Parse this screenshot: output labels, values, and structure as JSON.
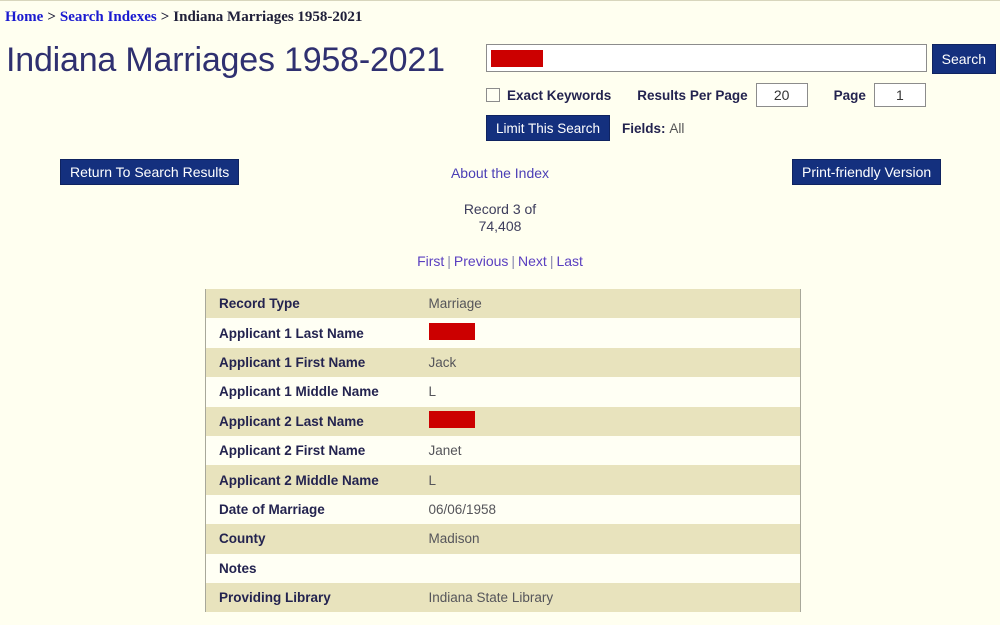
{
  "breadcrumb": {
    "home": "Home",
    "separator": ">",
    "search_indexes": "Search Indexes",
    "current": "Indiana Marriages 1958-2021"
  },
  "page_title": "Indiana Marriages 1958-2021",
  "search": {
    "query_value": "",
    "query_redacted": true,
    "search_button": "Search",
    "exact_keywords_label": "Exact Keywords",
    "exact_keywords_checked": false,
    "results_per_page_label": "Results Per Page",
    "results_per_page_value": "20",
    "page_label": "Page",
    "page_value": "1",
    "limit_search_button": "Limit This Search",
    "fields_label": "Fields:",
    "fields_value": "All"
  },
  "actions": {
    "return_button": "Return To Search Results",
    "print_button": "Print-friendly Version"
  },
  "nav": {
    "about_link": "About the Index",
    "record_position": "Record 3 of 74,408",
    "first": "First",
    "previous": "Previous",
    "next": "Next",
    "last": "Last",
    "divider": "|"
  },
  "record": {
    "rows": [
      {
        "label": "Record Type",
        "value": "Marriage",
        "redacted": false,
        "shade": "tan"
      },
      {
        "label": "Applicant 1 Last Name",
        "value": "",
        "redacted": true,
        "shade": "light"
      },
      {
        "label": "Applicant 1 First Name",
        "value": "Jack",
        "redacted": false,
        "shade": "tan"
      },
      {
        "label": "Applicant 1 Middle Name",
        "value": "L",
        "redacted": false,
        "shade": "light"
      },
      {
        "label": "Applicant 2 Last Name",
        "value": "",
        "redacted": true,
        "shade": "tan"
      },
      {
        "label": "Applicant 2 First Name",
        "value": "Janet",
        "redacted": false,
        "shade": "light"
      },
      {
        "label": "Applicant 2 Middle Name",
        "value": "L",
        "redacted": false,
        "shade": "tan"
      },
      {
        "label": "Date of Marriage",
        "value": "06/06/1958",
        "redacted": false,
        "shade": "light"
      },
      {
        "label": "County",
        "value": "Madison",
        "redacted": false,
        "shade": "tan"
      },
      {
        "label": "Notes",
        "value": "",
        "redacted": false,
        "shade": "light"
      },
      {
        "label": "Providing Library",
        "value": "Indiana State Library",
        "redacted": false,
        "shade": "tan"
      }
    ]
  },
  "colors": {
    "page_background": "#fffff0",
    "navy_button": "#14307e",
    "row_tan": "#e8e3bd",
    "row_light": "#fffff4",
    "redaction": "#cc0000",
    "title": "#2f3070",
    "link_blue": "#1a1ad0",
    "link_purple": "#5a3fc0"
  }
}
